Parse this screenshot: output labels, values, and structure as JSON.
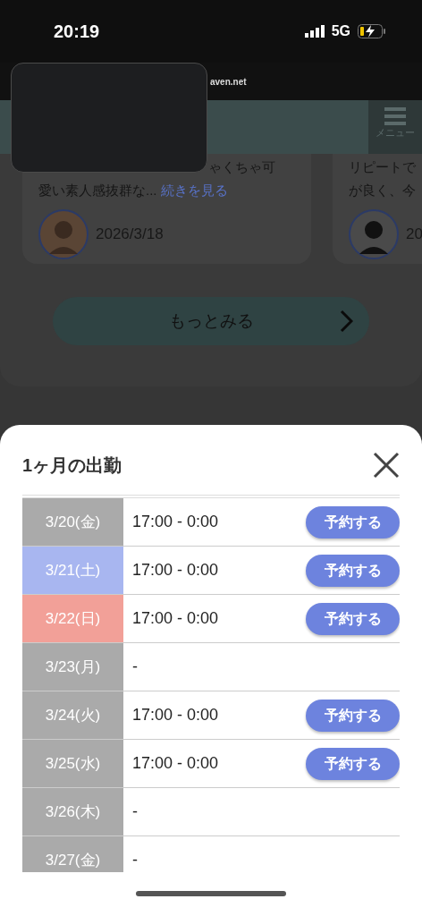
{
  "status_bar": {
    "time": "20:19",
    "network": "5G"
  },
  "browser": {
    "url": "aven.net"
  },
  "header": {
    "menu_label": "メニュー"
  },
  "reviews": [
    {
      "lines": [
        "ゃくちゃ可"
      ],
      "excerpt": "愛い素人感抜群な...",
      "more_link": "続きを見る",
      "date": "2026/3/18"
    },
    {
      "lines": [
        "リピートで",
        "が良く、今"
      ],
      "date": "20"
    }
  ],
  "more_button": "もっとみる",
  "sheet": {
    "title": "1ヶ月の出勤",
    "rows": [
      {
        "date": "3/20(金)",
        "color": "#aaaaaa",
        "hours": "17:00 - 0:00",
        "reserve": "予約する"
      },
      {
        "date": "3/21(土)",
        "color": "#a8b6f0",
        "hours": "17:00 - 0:00",
        "reserve": "予約する"
      },
      {
        "date": "3/22(日)",
        "color": "#f2a098",
        "hours": "17:00 - 0:00",
        "reserve": "予約する"
      },
      {
        "date": "3/23(月)",
        "color": "#aaaaaa",
        "hours": "-"
      },
      {
        "date": "3/24(火)",
        "color": "#aaaaaa",
        "hours": "17:00 - 0:00",
        "reserve": "予約する"
      },
      {
        "date": "3/25(水)",
        "color": "#aaaaaa",
        "hours": "17:00 - 0:00",
        "reserve": "予約する"
      },
      {
        "date": "3/26(木)",
        "color": "#aaaaaa",
        "hours": "-"
      },
      {
        "date": "3/27(金)",
        "color": "#aaaaaa",
        "hours": "-"
      }
    ]
  }
}
